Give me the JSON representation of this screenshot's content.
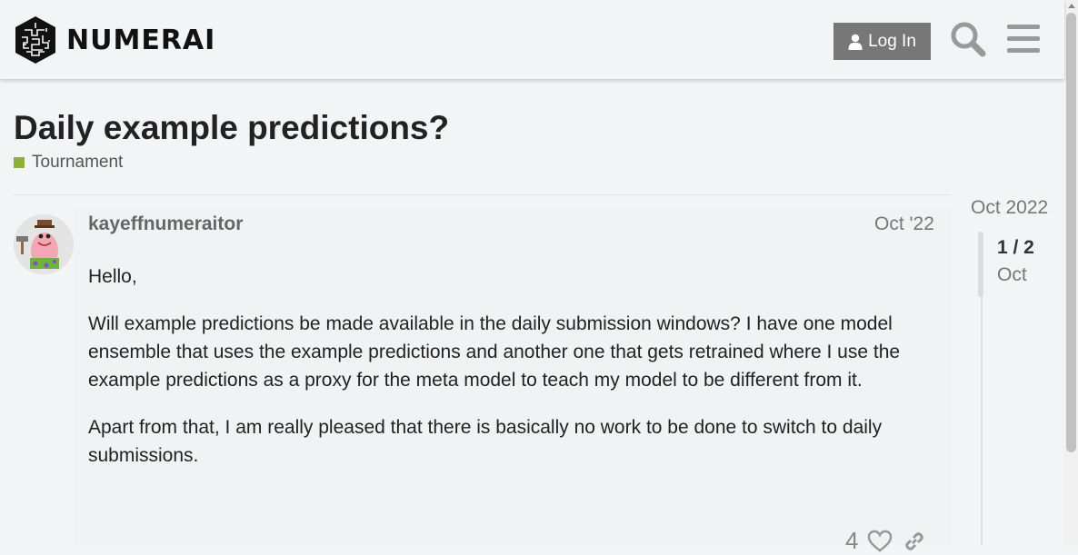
{
  "header": {
    "logo_text": "NUMERAI",
    "login_label": "Log In",
    "icons": [
      "user-icon",
      "search-icon",
      "hamburger-menu-icon"
    ]
  },
  "topic": {
    "title": "Daily example predictions?",
    "category": {
      "name": "Tournament",
      "color": "#8cb13a"
    }
  },
  "post": {
    "username": "kayeffnumeraitor",
    "date": "Oct '22",
    "paragraphs": [
      "Hello,",
      "Will example predictions be made available in the daily submission windows? I have one model ensemble that uses the example predictions and another one that gets retrained where I use the example predictions as a proxy for the meta model to teach my model to be different from it.",
      "Apart from that, I am really pleased that there is basically no work to be done to switch to daily submissions."
    ],
    "like_count": "4",
    "action_icons": [
      "heart-icon",
      "link-icon"
    ]
  },
  "timeline": {
    "start_date": "Oct 2022",
    "position": "1 / 2",
    "current_date": "Oct"
  }
}
